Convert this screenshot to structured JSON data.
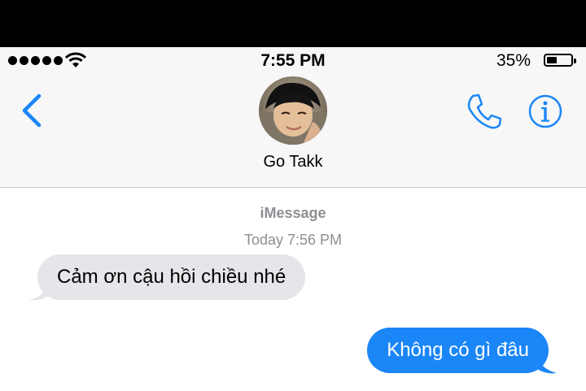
{
  "status_bar": {
    "time": "7:55 PM",
    "battery_percent": "35%",
    "battery_level": 0.35,
    "signal_dots": 5
  },
  "header": {
    "contact_name": "Go Takk",
    "back_icon": "chevron-left-icon",
    "call_icon": "phone-icon",
    "info_icon": "info-icon",
    "accent_color": "#1a86f8"
  },
  "conversation": {
    "service_label": "iMessage",
    "timestamp": "Today 7:56 PM",
    "messages": [
      {
        "direction": "incoming",
        "text": "Cảm ơn cậu hồi chiều nhé"
      },
      {
        "direction": "outgoing",
        "text": "Không có gì đâu"
      }
    ]
  },
  "colors": {
    "incoming_bubble": "#e5e5ea",
    "outgoing_bubble": "#1a86f8",
    "meta_text": "#8e8e93"
  }
}
